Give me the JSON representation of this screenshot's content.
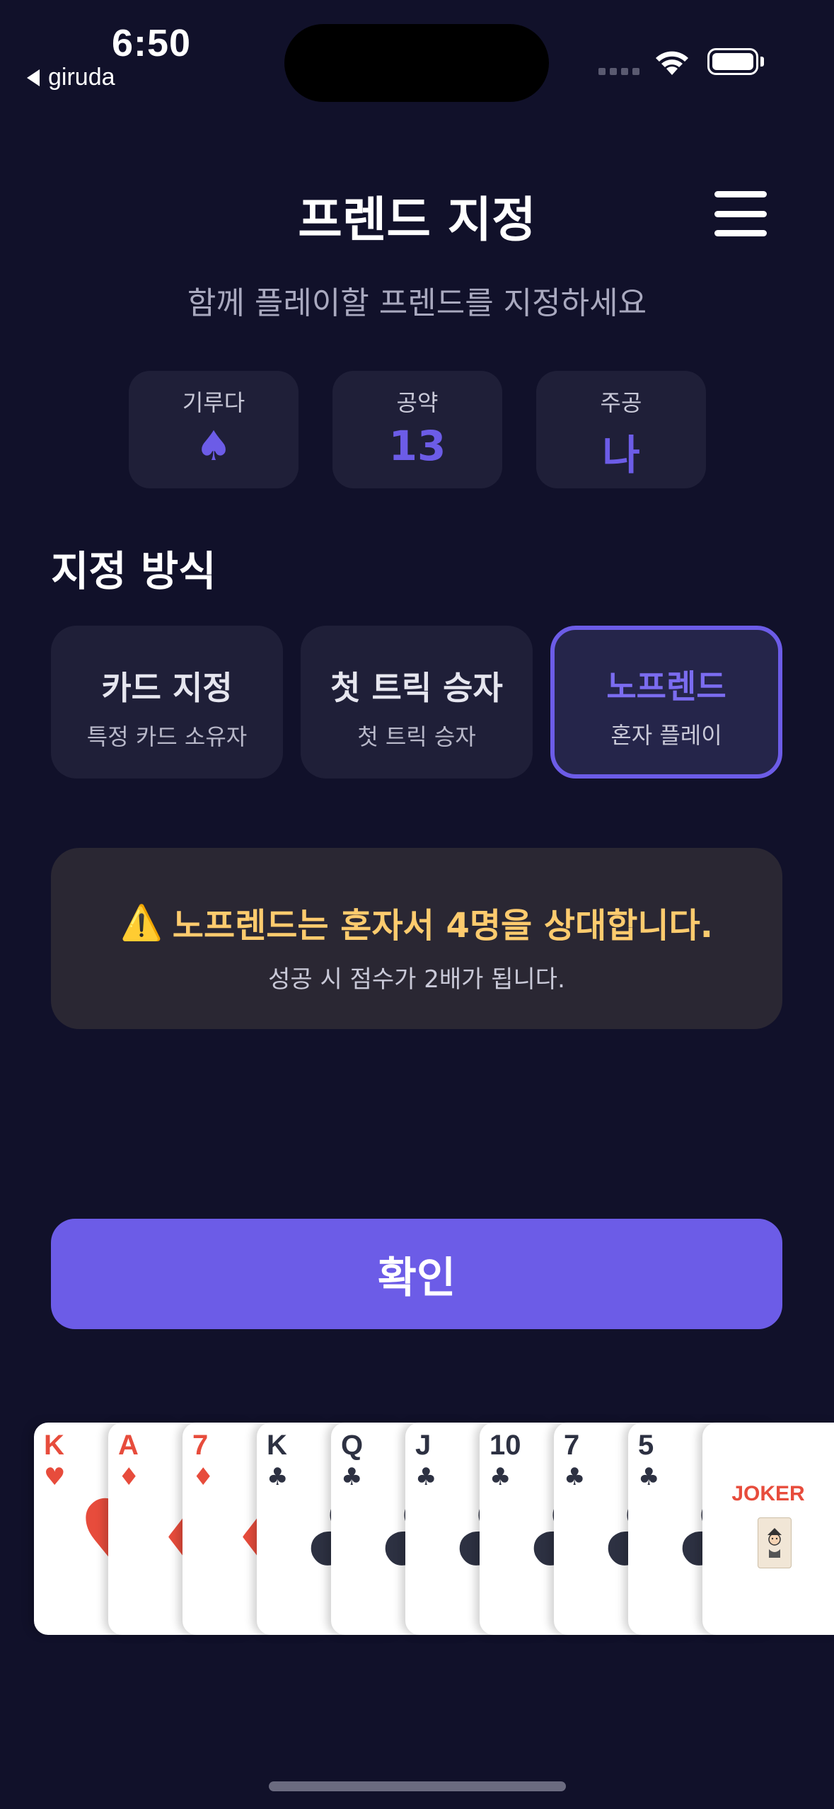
{
  "status_bar": {
    "time": "6:50",
    "back_app": "giruda"
  },
  "header": {
    "title": "프렌드 지정",
    "subtitle": "함께 플레이할 프렌드를 지정하세요"
  },
  "info": [
    {
      "label": "기루다",
      "value": "♠"
    },
    {
      "label": "공약",
      "value": "13"
    },
    {
      "label": "주공",
      "value": "나"
    }
  ],
  "section": {
    "title": "지정 방식"
  },
  "modes": [
    {
      "title": "카드 지정",
      "subtitle": "특정 카드 소유자",
      "selected": false
    },
    {
      "title": "첫 트릭 승자",
      "subtitle": "첫 트릭 승자",
      "selected": false
    },
    {
      "title": "노프렌드",
      "subtitle": "혼자 플레이",
      "selected": true
    }
  ],
  "warning": {
    "icon": "⚠️",
    "message": "노프렌드는 혼자서 4명을 상대합니다.",
    "detail": "성공 시 점수가 2배가 됩니다."
  },
  "confirm_label": "확인",
  "hand": [
    {
      "rank": "K",
      "suit": "♥",
      "color": "red"
    },
    {
      "rank": "A",
      "suit": "♦",
      "color": "red"
    },
    {
      "rank": "7",
      "suit": "♦",
      "color": "red"
    },
    {
      "rank": "K",
      "suit": "♣",
      "color": "black"
    },
    {
      "rank": "Q",
      "suit": "♣",
      "color": "black"
    },
    {
      "rank": "J",
      "suit": "♣",
      "color": "black"
    },
    {
      "rank": "10",
      "suit": "♣",
      "color": "black"
    },
    {
      "rank": "7",
      "suit": "♣",
      "color": "black"
    },
    {
      "rank": "5",
      "suit": "♣",
      "color": "black"
    },
    {
      "rank": "JOKER",
      "suit": "",
      "color": "red"
    }
  ],
  "colors": {
    "background": "#11112a",
    "accent": "#6c5ce7",
    "warning_text": "#fdcb6e",
    "card_red": "#e74c3c",
    "card_black": "#2d3142"
  }
}
